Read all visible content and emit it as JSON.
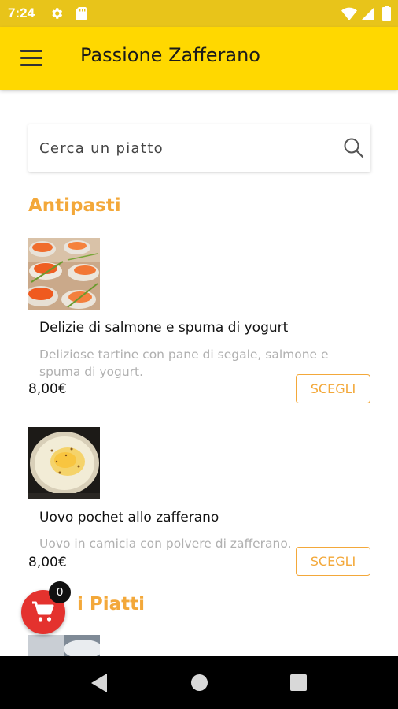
{
  "status_bar": {
    "time": "7:24",
    "icons": [
      "gear-icon",
      "sd-card-icon",
      "wifi-icon",
      "signal-icon",
      "battery-icon"
    ]
  },
  "app_bar": {
    "title": "Passione Zafferano",
    "menu_icon": "menu-icon"
  },
  "search": {
    "placeholder": "Cerca un piatto",
    "value": "",
    "icon": "search-icon"
  },
  "sections": [
    {
      "title": "Antipasti",
      "dishes": [
        {
          "name": "Delizie di salmone e spuma di yogurt",
          "description": "Deliziose tartine con pane di segale, salmone e spuma di yogurt.",
          "price": "8,00€",
          "action": "SCEGLI",
          "image": "salmon-canape-photo"
        },
        {
          "name": "Uovo pochet allo zafferano",
          "description": "Uovo in camicia con polvere di zafferano.",
          "price": "8,00€",
          "action": "SCEGLI",
          "image": "poached-egg-photo"
        }
      ]
    },
    {
      "title": "i Piatti"
    }
  ],
  "cart": {
    "count": "0",
    "icon": "cart-icon"
  },
  "nav_bar": {
    "icons": [
      "back-icon",
      "home-icon",
      "recent-apps-icon"
    ]
  },
  "colors": {
    "status_bar": "#e8c41a",
    "app_bar": "#ffd800",
    "accent": "#f3a83a",
    "cart_fab": "#e4322e"
  }
}
